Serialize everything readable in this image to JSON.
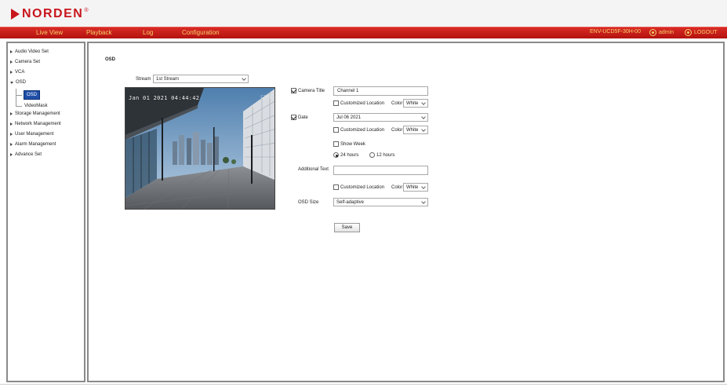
{
  "header": {
    "brand": "NORDEN",
    "brand_mark": "®"
  },
  "nav": {
    "items": [
      "Live View",
      "Playback",
      "Log",
      "Configuration"
    ],
    "device_id": "ENV-UCD5F-30H-00",
    "user": "admin",
    "logout": "LOGOUT",
    "user_icon": "user-circle-icon",
    "logout_icon": "power-circle-icon"
  },
  "sidebar": {
    "items": [
      {
        "label": "Audio Video Set",
        "expanded": false
      },
      {
        "label": "Camera Set",
        "expanded": false
      },
      {
        "label": "VCA",
        "expanded": false
      },
      {
        "label": "OSD",
        "expanded": true
      },
      {
        "label": "Storage Management",
        "expanded": false
      },
      {
        "label": "Network Management",
        "expanded": false
      },
      {
        "label": "User Management",
        "expanded": false
      },
      {
        "label": "Alarm Management",
        "expanded": false
      },
      {
        "label": "Advance Set",
        "expanded": false
      }
    ],
    "osd_children": [
      "OSD",
      "VideoMask"
    ],
    "selected": "OSD"
  },
  "main": {
    "title": "OSD",
    "stream_label": "Stream",
    "stream_value": "1st Stream",
    "preview": {
      "timestamp": "Jan 01 2021 04:44:42",
      "camera_overlay": "CH 1"
    },
    "camera_title": {
      "label": "Camera Title",
      "checked": true,
      "value": "Channel 1",
      "customized_location_label": "Customized Location",
      "customized_location_checked": false,
      "color_label": "Color",
      "color_value": "White"
    },
    "date": {
      "label": "Date",
      "checked": true,
      "value": "Jul 06 2021",
      "customized_location_label": "Customized Location",
      "customized_location_checked": false,
      "color_label": "Color",
      "color_value": "White",
      "show_week_label": "Show Week",
      "show_week_checked": false,
      "hour_24_label": "24 hours",
      "hour_12_label": "12 hours",
      "hour_format": "24"
    },
    "additional_text": {
      "label": "Additional Text",
      "value": "",
      "customized_location_label": "Customized Location",
      "customized_location_checked": false,
      "color_label": "Color",
      "color_value": "White"
    },
    "osd_size": {
      "label": "OSD Size",
      "value": "Self-adaptive"
    },
    "save_label": "Save"
  },
  "colors": {
    "brand_red": "#c8161d",
    "nav_text": "#f3d06a",
    "selected_bg": "#1f4fa8"
  }
}
